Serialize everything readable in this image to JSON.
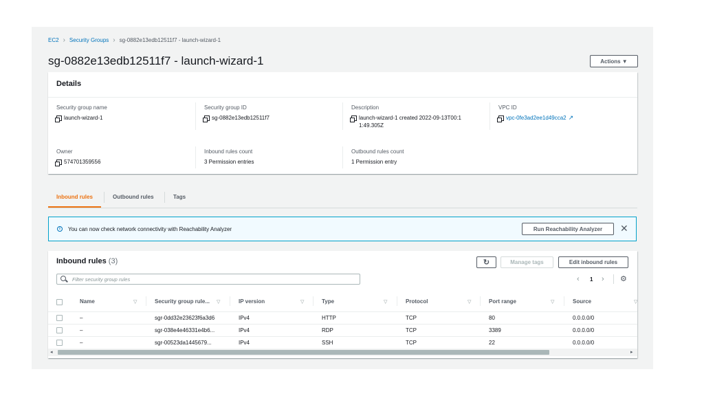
{
  "breadcrumb": [
    "EC2",
    "Security Groups",
    "sg-0882e13edb12511f7 - launch-wizard-1"
  ],
  "page_title": "sg-0882e13edb12511f7 - launch-wizard-1",
  "actions_label": "Actions ▼",
  "details": {
    "heading": "Details",
    "fields": [
      {
        "label": "Security group name",
        "value": "launch-wizard-1"
      },
      {
        "label": "Security group ID",
        "value": "sg-0882e13edb12511f7"
      },
      {
        "label": "Description",
        "value": "launch-wizard-1 created 2022-09-13T00:11:49.305Z"
      },
      {
        "label": "VPC ID",
        "value": "vpc-0fe3ad2ee1d49cca2"
      },
      {
        "label": "Owner",
        "value": "574701359556"
      },
      {
        "label": "Inbound rules count",
        "value": "3 Permission entries"
      },
      {
        "label": "Outbound rules count",
        "value": "1 Permission entry"
      }
    ]
  },
  "tabs": [
    "Inbound rules",
    "Outbound rules",
    "Tags"
  ],
  "alert": {
    "text": "You can now check network connectivity with Reachability Analyzer",
    "button": "Run Reachability Analyzer"
  },
  "inbound": {
    "title": "Inbound rules",
    "count": "(3)",
    "manage_tags": "Manage tags",
    "edit_rules": "Edit inbound rules",
    "search_placeholder": "Filter security group rules",
    "page": "1",
    "columns": [
      "Name",
      "Security group rule...",
      "IP version",
      "Type",
      "Protocol",
      "Port range",
      "Source"
    ],
    "rows": [
      [
        "–",
        "sgr-0dd32e23623f6a3d6",
        "IPv4",
        "HTTP",
        "TCP",
        "80",
        "0.0.0.0/0"
      ],
      [
        "–",
        "sgr-038e4e46331e4b6...",
        "IPv4",
        "RDP",
        "TCP",
        "3389",
        "0.0.0.0/0"
      ],
      [
        "–",
        "sgr-00523da1445679...",
        "IPv4",
        "SSH",
        "TCP",
        "22",
        "0.0.0.0/0"
      ]
    ]
  },
  "colors": {
    "accent": "#ec7211",
    "link": "#0073bb",
    "info_border": "#00a1c9"
  }
}
